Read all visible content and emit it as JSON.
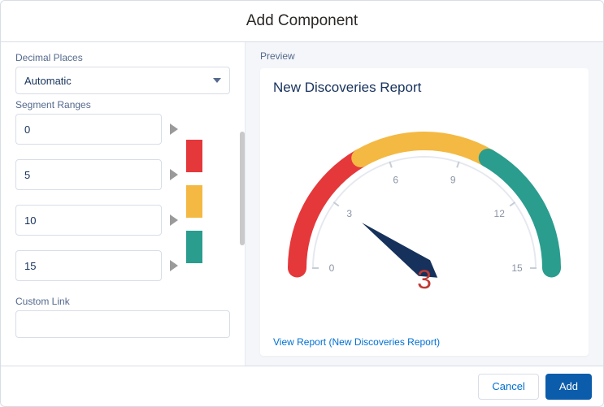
{
  "modal": {
    "title": "Add Component"
  },
  "form": {
    "decimalPlaces": {
      "label": "Decimal Places",
      "value": "Automatic"
    },
    "segmentRanges": {
      "label": "Segment Ranges",
      "values": [
        "0",
        "5",
        "10",
        "15"
      ],
      "colors": [
        "#e5383b",
        "#f4b942",
        "#2a9d8f"
      ]
    },
    "customLink": {
      "label": "Custom Link",
      "value": ""
    }
  },
  "preview": {
    "label": "Preview",
    "reportTitle": "New Discoveries Report",
    "viewLink": "View Report (New Discoveries Report)"
  },
  "chart_data": {
    "type": "gauge",
    "title": "New Discoveries Report",
    "value": 3,
    "min": 0,
    "max": 15,
    "ticks": [
      0,
      3,
      6,
      9,
      12,
      15
    ],
    "segments": [
      {
        "from": 0,
        "to": 5,
        "color": "#e5383b"
      },
      {
        "from": 5,
        "to": 10,
        "color": "#f4b942"
      },
      {
        "from": 10,
        "to": 15,
        "color": "#2a9d8f"
      }
    ]
  },
  "footer": {
    "cancel": "Cancel",
    "add": "Add"
  }
}
